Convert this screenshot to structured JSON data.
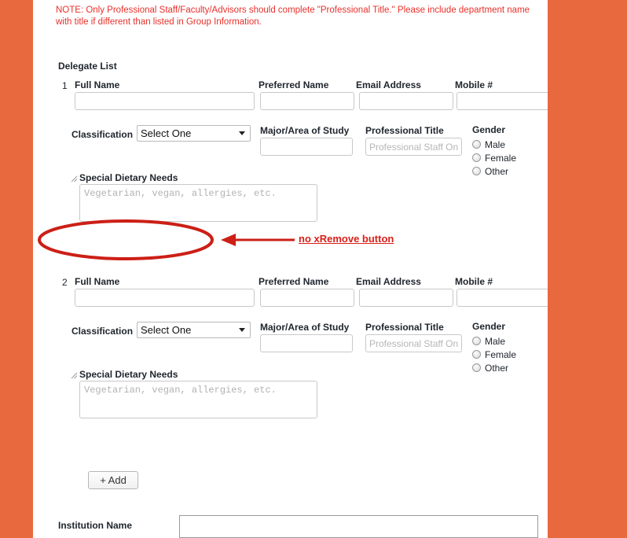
{
  "colors": {
    "page_background": "#e9693f",
    "content_background": "#ffffff",
    "note_text": "#e8302a",
    "annotation": "#d81f18",
    "label_text": "#20262e"
  },
  "note": {
    "text": "NOTE: Only Professional Staff/Faculty/Advisors should complete \"Professional Title.\" Please include department name with title if different than listed in Group Information."
  },
  "section": {
    "title": "Delegate List"
  },
  "field_labels": {
    "full_name": "Full Name",
    "preferred_name": "Preferred Name",
    "email_address": "Email Address",
    "mobile": "Mobile #",
    "classification": "Classification",
    "major": "Major/Area of Study",
    "professional_title": "Professional Title",
    "gender": "Gender",
    "dietary": "Special Dietary Needs"
  },
  "placeholders": {
    "full_name": "",
    "preferred_name": "",
    "email_address": "",
    "mobile": "",
    "major": "",
    "professional_title": "Professional Staff Only",
    "dietary": "Vegetarian, vegan, allergies, etc."
  },
  "classification": {
    "selected": "Select One",
    "options": [
      "Select One"
    ]
  },
  "gender_options": [
    "Male",
    "Female",
    "Other"
  ],
  "delegates": [
    {
      "number": "1",
      "full_name": "",
      "preferred_name": "",
      "email_address": "",
      "mobile": "",
      "classification": "Select One",
      "major": "",
      "professional_title": "",
      "dietary": ""
    },
    {
      "number": "2",
      "full_name": "",
      "preferred_name": "",
      "email_address": "",
      "mobile": "",
      "classification": "Select One",
      "major": "",
      "professional_title": "",
      "dietary": ""
    }
  ],
  "buttons": {
    "add": "+ Add"
  },
  "institution": {
    "label": "Institution Name",
    "value": "",
    "placeholder": ""
  },
  "annotation": {
    "text": "no xRemove button",
    "shapes": [
      "ellipse",
      "arrow"
    ]
  }
}
